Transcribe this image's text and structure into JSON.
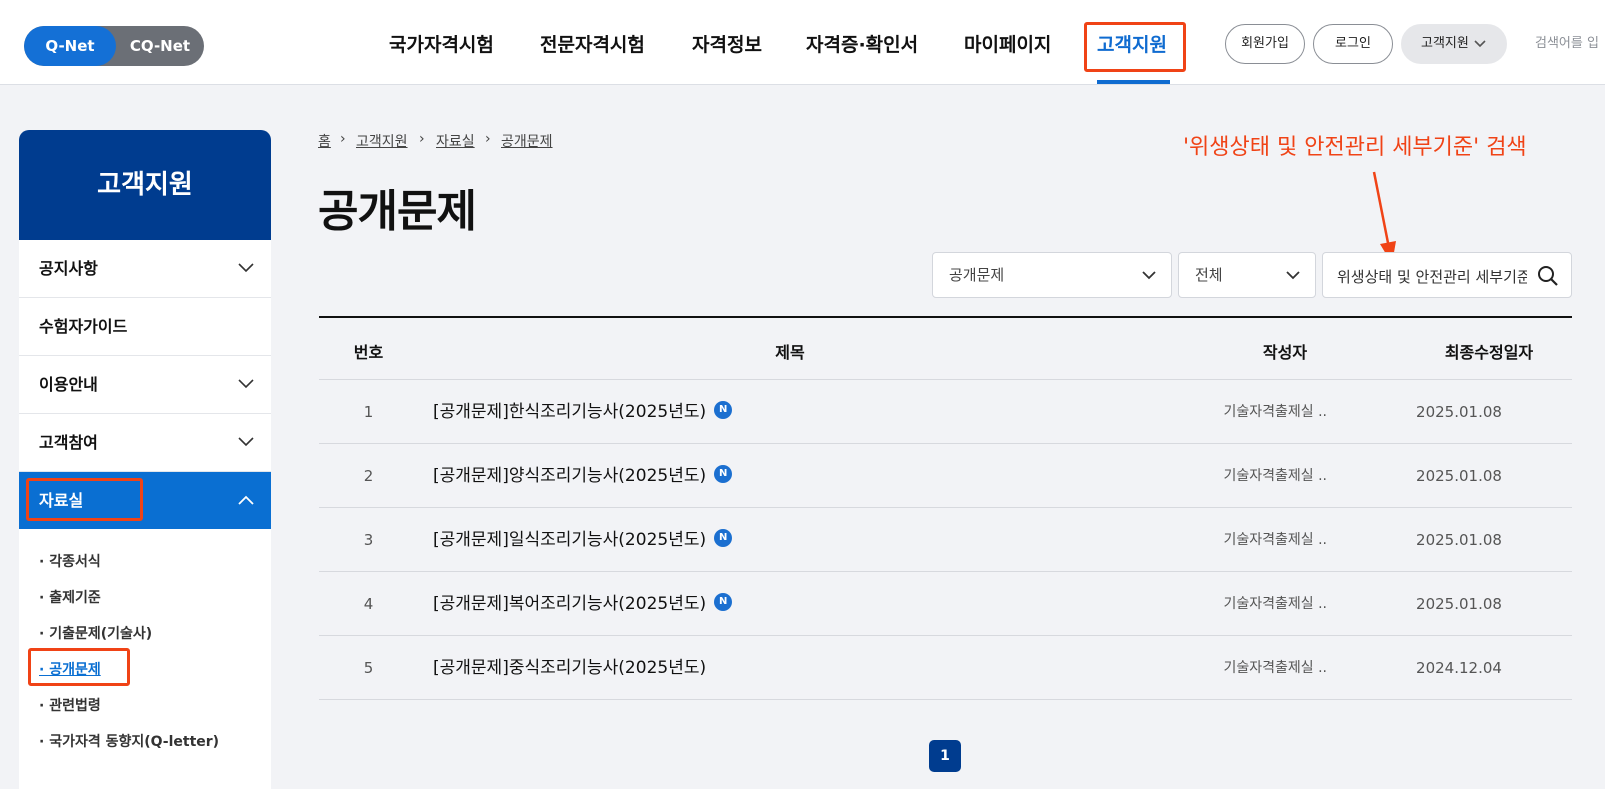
{
  "header": {
    "net_toggle": {
      "qnet": "Q-Net",
      "cqnet": "CQ-Net"
    },
    "nav": [
      "국가자격시험",
      "전문자격시험",
      "자격정보",
      "자격증·확인서",
      "마이페이지",
      "고객지원"
    ],
    "buttons": {
      "signup": "회원가입",
      "login": "로그인",
      "support": "고객지원"
    },
    "search_hint": "검색어를 입"
  },
  "sidebar": {
    "title": "고객지원",
    "items": [
      "공지사항",
      "수험자가이드",
      "이용안내",
      "고객참여",
      "자료실"
    ],
    "sub_items": [
      "· 각종서식",
      "· 출제기준",
      "· 기출문제(기술사)",
      "· 공개문제",
      "· 관련법령",
      "· 국가자격 동향지(Q-letter)"
    ]
  },
  "breadcrumb": [
    "홈",
    "고객지원",
    "자료실",
    "공개문제"
  ],
  "main": {
    "title": "공개문제",
    "annotation": "'위생상태 및 안전관리 세부기준' 검색",
    "filter_category": "공개문제",
    "filter_scope": "전체",
    "search_value": "위생상태 및 안전관리 세부기준"
  },
  "table": {
    "headers": [
      "번호",
      "제목",
      "작성자",
      "최종수정일자"
    ],
    "rows": [
      {
        "num": "1",
        "title": "[공개문제]한식조리기능사(2025년도)",
        "badge": "N",
        "author": "기술자격출제실 ..",
        "date": "2025.01.08"
      },
      {
        "num": "2",
        "title": "[공개문제]양식조리기능사(2025년도)",
        "badge": "N",
        "author": "기술자격출제실 ..",
        "date": "2025.01.08"
      },
      {
        "num": "3",
        "title": "[공개문제]일식조리기능사(2025년도)",
        "badge": "N",
        "author": "기술자격출제실 ..",
        "date": "2025.01.08"
      },
      {
        "num": "4",
        "title": "[공개문제]복어조리기능사(2025년도)",
        "badge": "N",
        "author": "기술자격출제실 ..",
        "date": "2025.01.08"
      },
      {
        "num": "5",
        "title": "[공개문제]중식조리기능사(2025년도)",
        "badge": "",
        "author": "기술자격출제실 ..",
        "date": "2024.12.04"
      }
    ]
  },
  "pagination": {
    "current": "1"
  },
  "colors": {
    "primary": "#0f6bd0",
    "navy": "#003c8f",
    "highlight": "#f04316"
  },
  "icons": [
    "chevron-down-icon",
    "chevron-up-icon",
    "search-icon",
    "breadcrumb-separator-icon",
    "annotation-arrow-icon"
  ]
}
